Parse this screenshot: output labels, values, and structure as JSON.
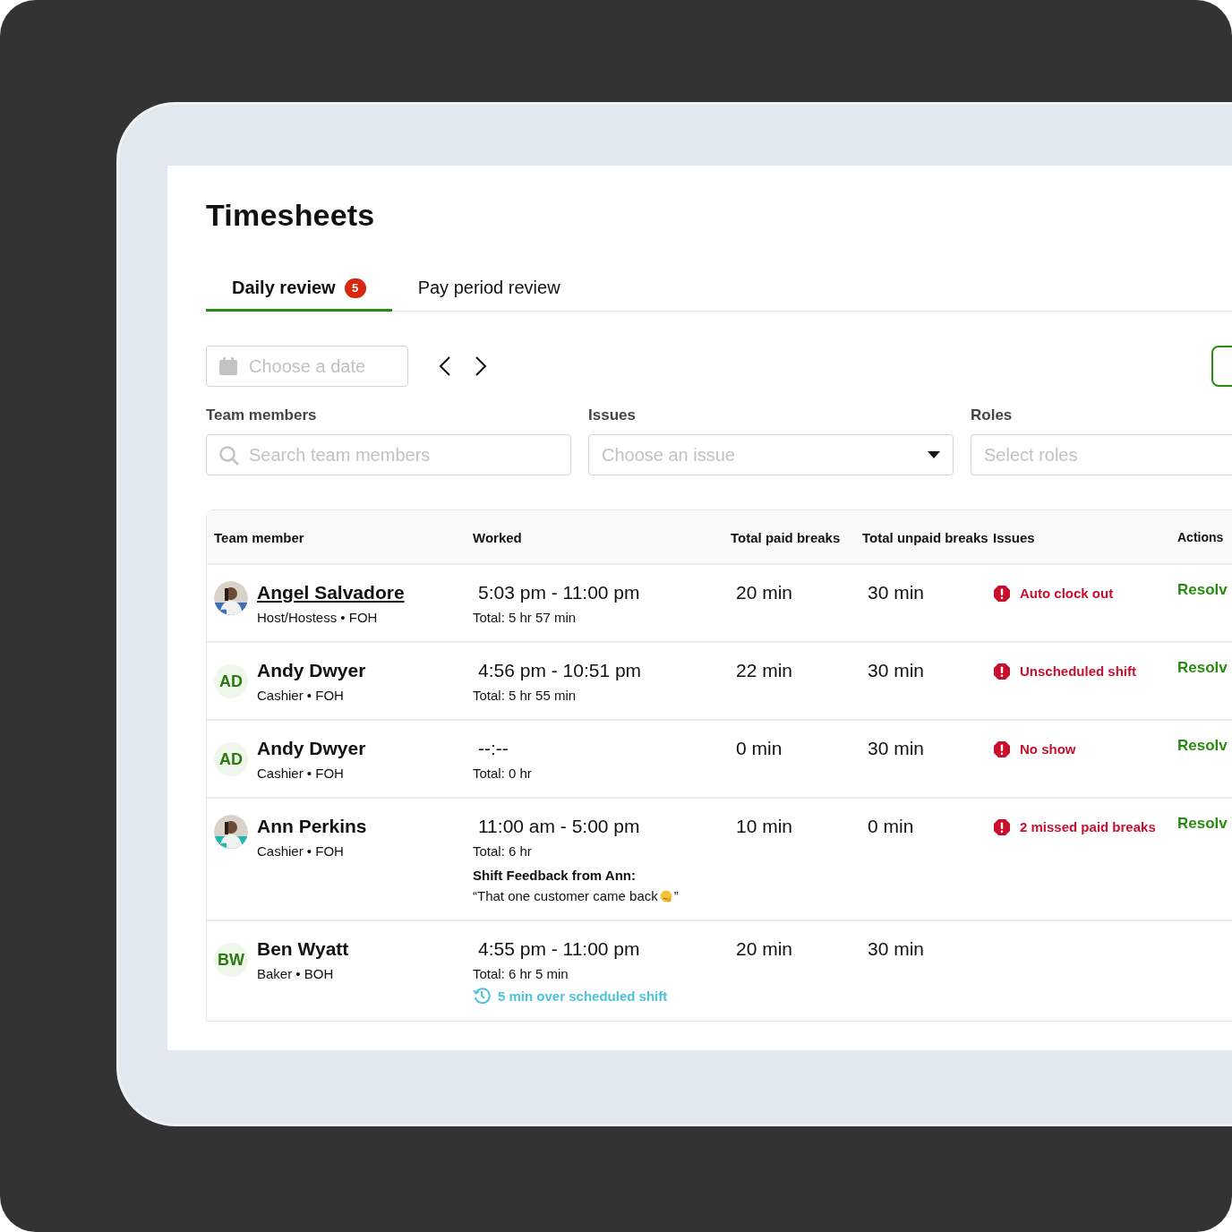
{
  "page": {
    "title": "Timesheets"
  },
  "tabs": [
    {
      "label": "Daily review",
      "badge": "5",
      "selected": true
    },
    {
      "label": "Pay period review",
      "selected": false
    }
  ],
  "date_field": {
    "placeholder": "Choose a date"
  },
  "filters": [
    {
      "label": "Team members",
      "kind": "search",
      "placeholder": "Search team members"
    },
    {
      "label": "Issues",
      "kind": "dropdown",
      "placeholder": "Choose an issue"
    },
    {
      "label": "Roles",
      "kind": "select",
      "placeholder": "Select roles"
    }
  ],
  "table": {
    "columns": [
      "Team member",
      "Worked",
      "Total paid breaks",
      "Total unpaid breaks",
      "Issues",
      "Actions"
    ],
    "rows": [
      {
        "name": "Angel Salvadore",
        "link": true,
        "role": "Host/Hostess • FOH",
        "worked": "5:03 pm - 11:00 pm",
        "total": "Total: 5 hr 57 min",
        "paid_breaks": "20 min",
        "unpaid_breaks": "30 min",
        "issue": "Auto clock out",
        "action": "Resolv"
      },
      {
        "avatar": {
          "kind": "initials",
          "initials": "AD"
        },
        "name": "Andy Dwyer",
        "link": false,
        "role": "Cashier • FOH",
        "worked": "4:56 pm - 10:51 pm",
        "total": "Total: 5 hr 55 min",
        "paid_breaks": "22 min",
        "unpaid_breaks": "30 min",
        "issue": "Unscheduled shift",
        "action": "Resolv"
      },
      {
        "avatar": {
          "kind": "initials",
          "initials": "AD"
        },
        "name": "Andy Dwyer",
        "link": false,
        "role": "Cashier • FOH",
        "worked": "--:--",
        "total": "Total: 0 hr",
        "paid_breaks": "0 min",
        "unpaid_breaks": "30 min",
        "issue": "No show",
        "action": "Resolv"
      },
      {
        "name": "Ann Perkins",
        "link": false,
        "role": "Cashier • FOH",
        "worked": "11:00 am - 5:00 pm",
        "total": "Total: 6 hr",
        "feedback": {
          "heading": "Shift Feedback from Ann:",
          "quote": "“That one customer came back",
          "quote_end": "”"
        },
        "paid_breaks": "10 min",
        "unpaid_breaks": "0 min",
        "issue": "2 missed paid breaks",
        "action": "Resolv"
      },
      {
        "avatar": {
          "kind": "initials",
          "initials": "BW"
        },
        "name": "Ben Wyatt",
        "link": false,
        "role": "Baker • BOH",
        "worked": "4:55 pm - 11:00 pm",
        "total": "Total: 6 hr 5 min",
        "note": "5 min over scheduled shift",
        "paid_breaks": "20 min",
        "unpaid_breaks": "30 min"
      }
    ]
  }
}
